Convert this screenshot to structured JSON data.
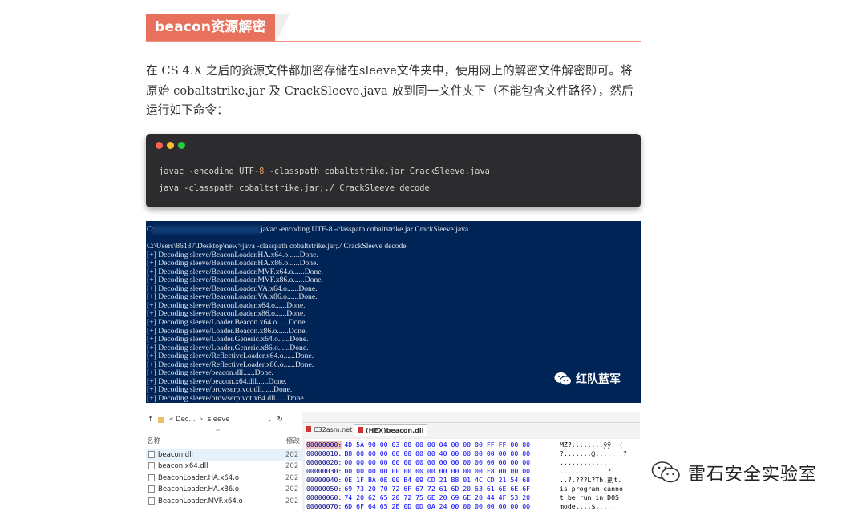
{
  "heading": {
    "title": "beacon资源解密"
  },
  "paragraph": {
    "text": "在 CS 4.X 之后的资源文件都加密存储在sleeve文件夹中，使用网上的解密文件解密即可。将原始 cobaltstrike.jar 及 CrackSleeve.java 放到同一文件夹下（不能包含文件路径），然后运行如下命令："
  },
  "code": {
    "dots": [
      "#ff5f56",
      "#ffbd2e",
      "#27c93f"
    ],
    "line1_pre": "javac -encoding UTF-",
    "line1_num": "8",
    "line1_post": " -classpath cobaltstrike.jar CrackSleeve.java",
    "line2": "java -classpath cobaltstrike.jar;./ CrackSleeve decode"
  },
  "terminal": {
    "prompt_prefix": "C:",
    "cmd1": "javac -encoding UTF-8 -classpath cobaltstrike.jar CrackSleeve.java",
    "lines": [
      "C:\\Users\\86137\\Desktop\\new>java -classpath cobaltstrike.jar;./ CrackSleeve decode",
      "[+] Decoding sleeve/BeaconLoader.HA.x64.o......Done.",
      "[+] Decoding sleeve/BeaconLoader.HA.x86.o......Done.",
      "[+] Decoding sleeve/BeaconLoader.MVF.x64.o......Done.",
      "[+] Decoding sleeve/BeaconLoader.MVF.x86.o......Done.",
      "[+] Decoding sleeve/BeaconLoader.VA.x64.o......Done.",
      "[+] Decoding sleeve/BeaconLoader.VA.x86.o......Done.",
      "[+] Decoding sleeve/BeaconLoader.x64.o......Done.",
      "[+] Decoding sleeve/BeaconLoader.x86.o......Done.",
      "[+] Decoding sleeve/Loader.Beacon.x64.o......Done.",
      "[+] Decoding sleeve/Loader.Beacon.x86.o......Done.",
      "[+] Decoding sleeve/Loader.Generic.x64.o......Done.",
      "[+] Decoding sleeve/Loader.Generic.x86.o......Done.",
      "[+] Decoding sleeve/ReflectiveLoader.x64.o......Done.",
      "[+] Decoding sleeve/ReflectiveLoader.x86.o......Done.",
      "[+] Decoding sleeve/beacon.dll......Done.",
      "[+] Decoding sleeve/beacon.x64.dll......Done.",
      "[+] Decoding sleeve/browserpivot.dll......Done.",
      "[+] Decoding sleeve/browserpivot.x64.dll......Done."
    ],
    "watermark": "红队蓝军"
  },
  "explorer": {
    "breadcrumb": [
      "« Dec...",
      "sleeve"
    ],
    "col_name": "名称",
    "col_modified": "修改",
    "files": [
      {
        "name": "beacon.dll",
        "mod": "202"
      },
      {
        "name": "beacon.x64.dll",
        "mod": "202"
      },
      {
        "name": "BeaconLoader.HA.x64.o",
        "mod": "202"
      },
      {
        "name": "BeaconLoader.HA.x86.o",
        "mod": "202"
      },
      {
        "name": "BeaconLoader.MVF.x64.o",
        "mod": "202"
      }
    ]
  },
  "hex": {
    "tabs": [
      "C32asm.net",
      "(HEX)beacon.dll"
    ],
    "rows": [
      {
        "off": "00000000:",
        "bytes": "4D 5A 90 00 03 00 00 00 04 00 00 00 FF FF 00 00",
        "ascii": "MZ?........ÿÿ..("
      },
      {
        "off": "00000010:",
        "bytes": "B8 00 00 00 00 00 00 00 40 00 00 00 00 00 00 00",
        "ascii": "?.......@.......?"
      },
      {
        "off": "00000020:",
        "bytes": "00 00 00 00 00 00 00 00 00 00 00 00 00 00 00 00",
        "ascii": "................"
      },
      {
        "off": "00000030:",
        "bytes": "00 00 00 00 00 00 00 00 00 00 00 00 F8 00 00 00",
        "ascii": "............?..."
      },
      {
        "off": "00000040:",
        "bytes": "0E 1F BA 0E 00 B4 09 CD 21 B8 01 4C CD 21 54 68",
        "ascii": "..?.???L?Th.劃t."
      },
      {
        "off": "00000050:",
        "bytes": "69 73 20 70 72 6F 67 72 61 6D 20 63 61 6E 6E 6F",
        "ascii": "is program canno"
      },
      {
        "off": "00000060:",
        "bytes": "74 20 62 65 20 72 75 6E 20 69 6E 20 44 4F 53 20",
        "ascii": "t be run in DOS "
      },
      {
        "off": "00000070:",
        "bytes": "6D 6F 64 65 2E 0D 0D 0A 24 00 00 00 00 00 00 00",
        "ascii": "mode....$......."
      }
    ]
  },
  "watermark": {
    "text": "雷石安全实验室"
  }
}
